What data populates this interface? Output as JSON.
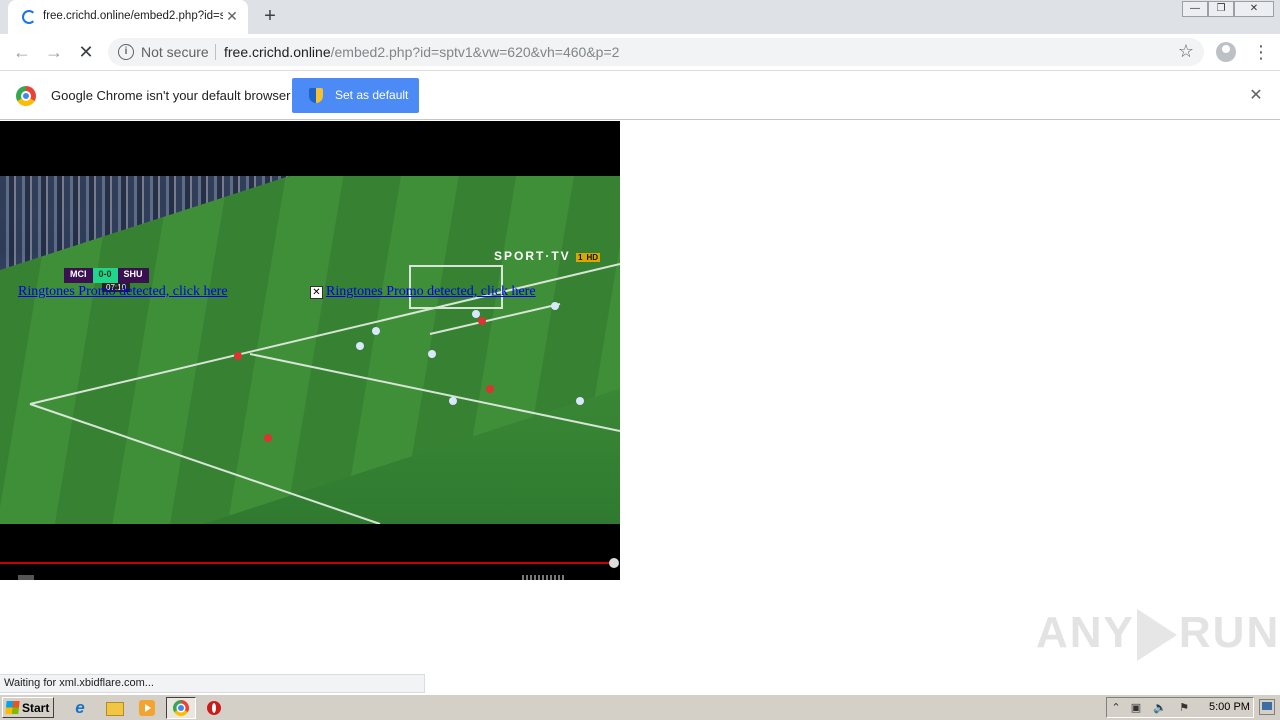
{
  "tab": {
    "title": "free.crichd.online/embed2.php?id=s",
    "close": "✕"
  },
  "new_tab": "+",
  "window_controls": {
    "minimize": "—",
    "restore": "❐",
    "close": "✕"
  },
  "toolbar": {
    "back": "←",
    "forward": "→",
    "stop": "✕",
    "security_label": "Not secure",
    "url_host": "free.crichd.online",
    "url_path": "/embed2.php?id=sptv1&vw=620&vh=460&p=2",
    "bookmark": "☆",
    "menu": "⋮"
  },
  "infobar": {
    "message": "Google Chrome isn't your default browser",
    "button": "Set as default",
    "close": "✕"
  },
  "video": {
    "team_home": "MCI",
    "score": "0-0",
    "team_away": "SHU",
    "match_clock": "07:10",
    "channel_logo": "SPORT·TV",
    "channel_number": "1",
    "channel_hd": "HD",
    "ad_link_left": "Ringtones Promo detected, click here",
    "ad_link_right": "Ringtones Promo detected, click here",
    "ad_close": "✕",
    "progress_fraction": 0.99
  },
  "status_text": "Waiting for xml.xbidflare.com...",
  "watermark": {
    "left": "ANY",
    "right": "RUN"
  },
  "taskbar": {
    "start_label": "Start",
    "ie_icon": "e",
    "clock": "5:00 PM",
    "tray_icons": [
      "⌃",
      "▣",
      "🔈",
      "⚑"
    ]
  },
  "colors": {
    "accent_blue": "#4c8bf5",
    "progress_red": "#cc0000",
    "taskbar_grey": "#d4d0c8"
  },
  "icons": {
    "tab_loading": "spinner-icon",
    "info": "info-icon",
    "star": "star-icon",
    "profile": "avatar-icon",
    "chrome": "chrome-logo-icon",
    "shield": "uac-shield-icon"
  }
}
